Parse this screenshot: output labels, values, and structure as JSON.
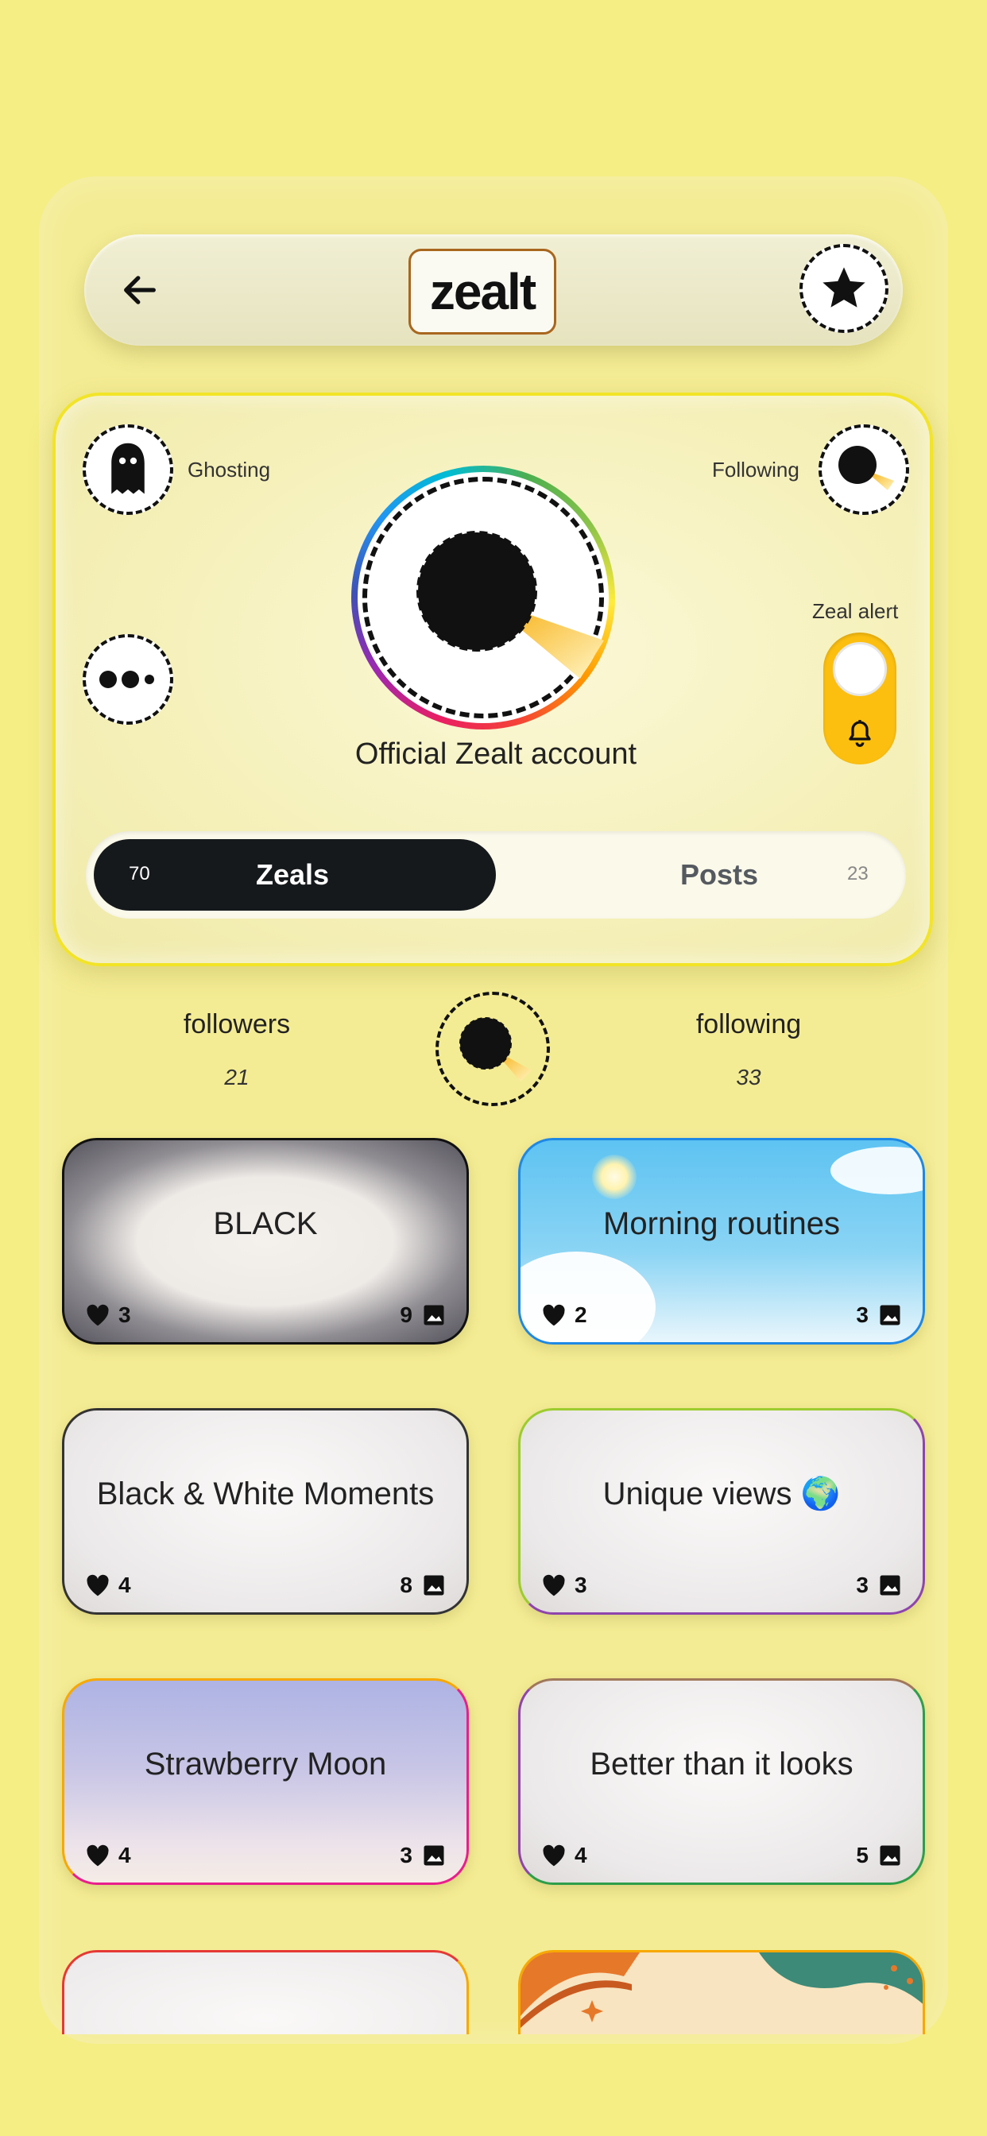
{
  "header": {
    "logo_text": "zealt",
    "back_icon": "arrow-left-icon",
    "favorite_icon": "star-icon"
  },
  "profile": {
    "ghosting_label": "Ghosting",
    "following_label": "Following",
    "account_name": "Official Zealt account",
    "zeal_alert_label": "Zeal alert",
    "zeal_alert_on": true,
    "more_icon": "dots-icon",
    "ghost_icon": "ghost-icon",
    "bell_icon": "bell-icon"
  },
  "tabs": {
    "zeals_label": "Zeals",
    "zeals_count": "70",
    "posts_label": "Posts",
    "posts_count": "23",
    "active": "Zeals"
  },
  "stats": {
    "followers_label": "followers",
    "followers_count": "21",
    "following_label": "following",
    "following_count": "33"
  },
  "zeals": [
    {
      "title": "BLACK",
      "likes": "3",
      "photos": "9"
    },
    {
      "title": "Morning routines",
      "likes": "2",
      "photos": "3"
    },
    {
      "title": "Black & White Moments",
      "likes": "4",
      "photos": "8"
    },
    {
      "title": "Unique views 🌍",
      "likes": "3",
      "photos": "3"
    },
    {
      "title": "Strawberry Moon",
      "likes": "4",
      "photos": "3"
    },
    {
      "title": "Better than it looks",
      "likes": "4",
      "photos": "5"
    }
  ],
  "colors": {
    "background": "#f5ee84",
    "card_border": "#f2e427",
    "toggle": "#fcbf10",
    "tab_active": "#16191c"
  }
}
